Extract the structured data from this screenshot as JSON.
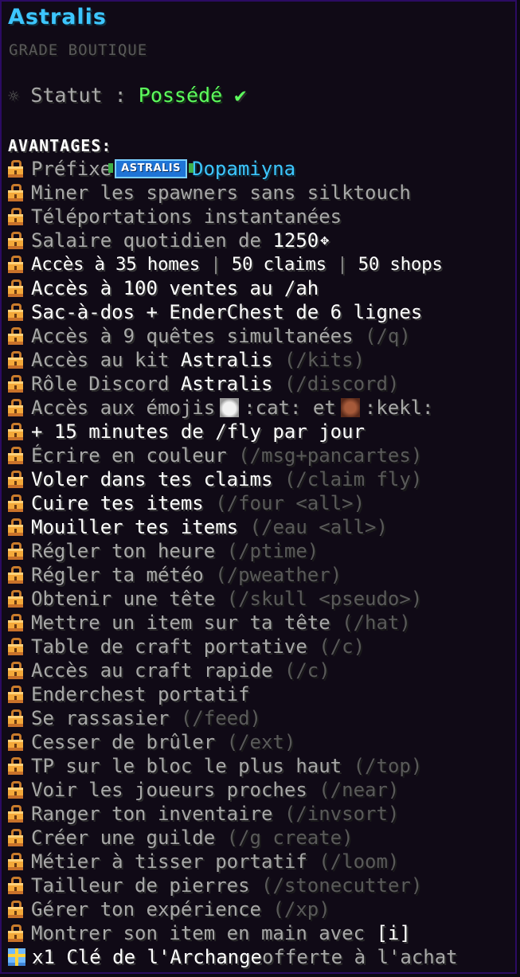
{
  "title": "Astralis",
  "subtitle": "GRADE BOUTIQUE",
  "status": {
    "label": "Statut : ",
    "value": "Possédé",
    "check": "✔"
  },
  "section_title": "AVANTAGES:",
  "prefix_row": {
    "label": "Préfixe",
    "badge": "ASTRALIS",
    "player": "Dopamiyna"
  },
  "perks": [
    {
      "a": "Miner les spawners sans silktouch",
      "b": "",
      "c": ""
    },
    {
      "a": "Téléportations instantanées",
      "b": "",
      "c": ""
    },
    {
      "a": "Salaire quotidien de ",
      "b": "1250",
      "c": "✥"
    },
    {
      "a": "Accès à 35 homes",
      "b": " | ",
      "c": "50 claims",
      "d": " | ",
      "e": "50 shops"
    },
    {
      "a": "Accès à 100 ventes au /ah",
      "b": "",
      "c": ""
    },
    {
      "a": "Sac-à-dos + EnderChest de 6 lignes",
      "b": "",
      "c": ""
    },
    {
      "a": "Accès à 9 quêtes simultanées",
      "b": " (/q)",
      "c": ""
    },
    {
      "a": "Accès au kit ",
      "b": "Astralis",
      "c": " (/kits)"
    },
    {
      "a": "Rôle Discord ",
      "b": "Astralis",
      "c": " (/discord)"
    }
  ],
  "emoji_row": {
    "a": "Accès aux émojis",
    "cat": ":cat:",
    "and": "et",
    "kekl": ":kekl:"
  },
  "commands": [
    {
      "a": "+ 15 minutes de /fly par jour",
      "b": ""
    },
    {
      "a": "Écrire en couleur",
      "b": " (/msg+pancartes)"
    },
    {
      "a": "Voler dans tes claims",
      "b": " (/claim fly)"
    },
    {
      "a": "Cuire tes items",
      "b": " (/four <all>)"
    },
    {
      "a": "Mouiller tes items",
      "b": " (/eau <all>)"
    },
    {
      "a": "Régler ton heure",
      "b": " (/ptime)"
    },
    {
      "a": "Régler ta météo",
      "b": " (/pweather)"
    },
    {
      "a": "Obtenir une tête",
      "b": " (/skull <pseudo>)"
    },
    {
      "a": "Mettre un item sur ta tête",
      "b": " (/hat)"
    },
    {
      "a": "Table de craft portative",
      "b": " (/c)"
    },
    {
      "a": "Accès au craft rapide",
      "b": " (/c)"
    },
    {
      "a": "Enderchest portatif",
      "b": ""
    },
    {
      "a": "Se rassasier",
      "b": " (/feed)"
    },
    {
      "a": "Cesser de brûler",
      "b": " (/ext)"
    },
    {
      "a": "TP sur le bloc le plus haut",
      "b": " (/top)"
    },
    {
      "a": "Voir les joueurs proches",
      "b": " (/near)"
    },
    {
      "a": "Ranger ton inventaire",
      "b": " (/invsort)"
    },
    {
      "a": "Créer une guilde",
      "b": " (/g create)"
    },
    {
      "a": "Métier à tisser portatif",
      "b": " (/loom)"
    },
    {
      "a": "Tailleur de pierres",
      "b": " (/stonecutter)"
    },
    {
      "a": "Gérer ton expérience",
      "b": " (/xp)"
    },
    {
      "a": "Montrer son item en main avec ",
      "b": "[i]"
    }
  ],
  "reward": {
    "a": "x1 Clé de l'Archange",
    "b": " offerte à l'achat"
  },
  "icons": {
    "perk": "lock-icon",
    "reward": "gift-icon",
    "status": "sun-icon"
  },
  "colors": {
    "title": "#3dc6ff",
    "owned": "#5dff5d",
    "text": "#a8a8a8",
    "highlight": "#ffffff",
    "muted": "#5a5a5a",
    "border": "#2c0b63"
  }
}
